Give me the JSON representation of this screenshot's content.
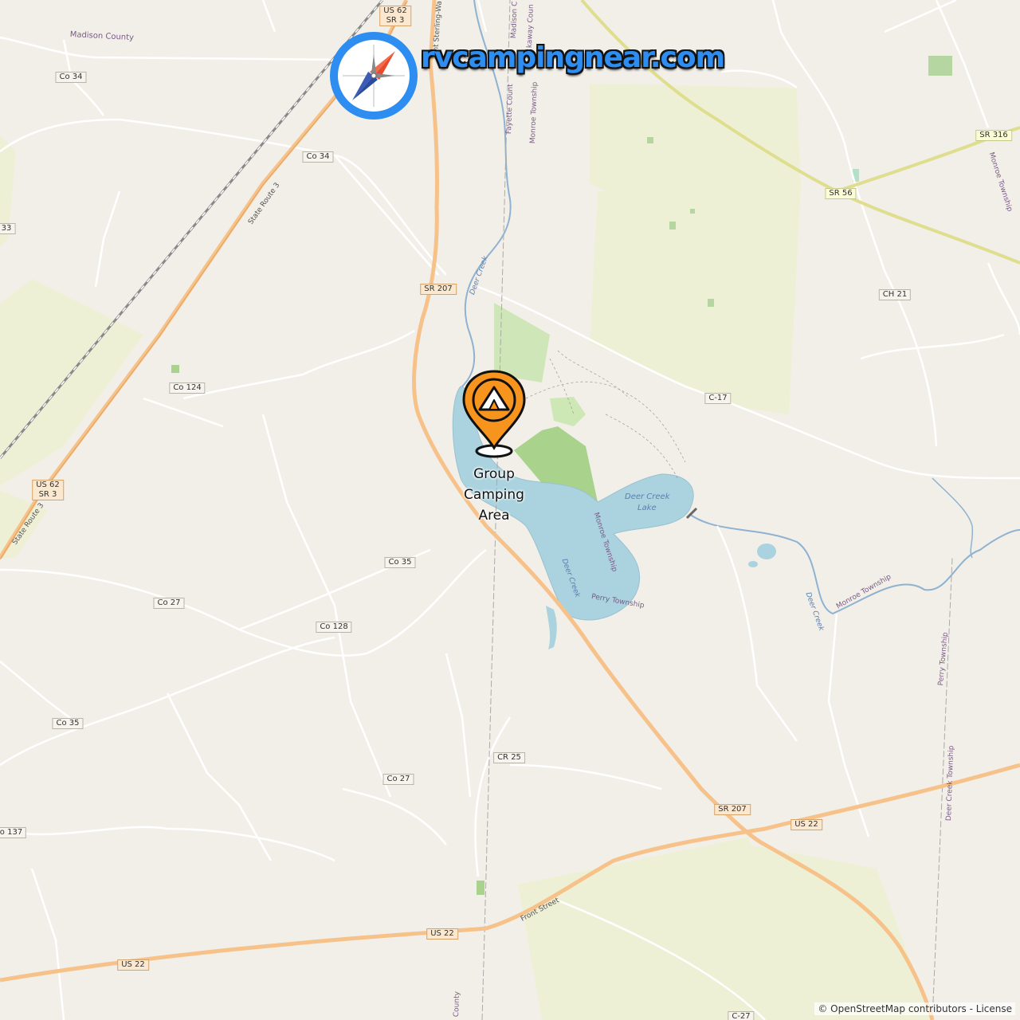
{
  "logo": {
    "text": "rvcampingnear.com",
    "compass": "compass-icon"
  },
  "marker": {
    "label": "Group\nCamping\nArea",
    "icon": "tent-pin-icon",
    "color": "#f7941d"
  },
  "attribution": "© OpenStreetMap contributors - License",
  "road_shields": [
    {
      "id": "us62-sr3-top",
      "text": "US 62\nSR 3",
      "kind": "highway"
    },
    {
      "id": "co34-a",
      "text": "Co 34",
      "kind": "local"
    },
    {
      "id": "co34-b",
      "text": "Co 34",
      "kind": "local"
    },
    {
      "id": "sr316",
      "text": "SR 316",
      "kind": "yellow"
    },
    {
      "id": "sr56",
      "text": "SR 56",
      "kind": "yellow"
    },
    {
      "id": "co33",
      "text": "33",
      "kind": "local"
    },
    {
      "id": "sr207-a",
      "text": "SR 207",
      "kind": "highway"
    },
    {
      "id": "ch21",
      "text": "CH 21",
      "kind": "local"
    },
    {
      "id": "co124",
      "text": "Co 124",
      "kind": "local"
    },
    {
      "id": "c17",
      "text": "C-17",
      "kind": "local"
    },
    {
      "id": "us62-sr3-bottom",
      "text": "US 62\nSR 3",
      "kind": "highway"
    },
    {
      "id": "co35-a",
      "text": "Co 35",
      "kind": "local"
    },
    {
      "id": "co27-a",
      "text": "Co 27",
      "kind": "local"
    },
    {
      "id": "co128",
      "text": "Co 128",
      "kind": "local"
    },
    {
      "id": "co35-b",
      "text": "Co 35",
      "kind": "local"
    },
    {
      "id": "cr25",
      "text": "CR 25",
      "kind": "local"
    },
    {
      "id": "co27-b",
      "text": "Co 27",
      "kind": "local"
    },
    {
      "id": "co137",
      "text": "o 137",
      "kind": "local"
    },
    {
      "id": "sr207-b",
      "text": "SR 207",
      "kind": "highway"
    },
    {
      "id": "us22-a",
      "text": "US 22",
      "kind": "highway"
    },
    {
      "id": "us22-b",
      "text": "US 22",
      "kind": "highway"
    },
    {
      "id": "us22-c",
      "text": "US 22",
      "kind": "highway"
    },
    {
      "id": "c27",
      "text": "C-27",
      "kind": "local"
    }
  ],
  "map_labels": {
    "madison_county": "Madison County",
    "state_route_3_a": "State Route 3",
    "state_route_3_b": "State Route 3",
    "deer_creek_a": "Deer Creek",
    "deer_creek_b": "Deer Creek",
    "deer_creek_c": "Deer Creek",
    "deer_creek_lake_1": "Deer Creek",
    "deer_creek_lake_2": "Lake",
    "monroe_township_a": "Monroe Township",
    "monroe_township_b": "Monroe Township",
    "monroe_township_c": "Monroe Township",
    "monroe_township_d": "Monroe Township",
    "perry_township_a": "Perry Township",
    "perry_township_b": "Perry Township",
    "deer_creek_township": "Deer Creek Township",
    "fayette_county": "Fayette Count",
    "madison_c": "Madison C",
    "pickaway_county": "kaway Coun",
    "mount_sterling": "unt Sterling-Wa",
    "front_street": "Front Street",
    "county_bottom": "County"
  }
}
